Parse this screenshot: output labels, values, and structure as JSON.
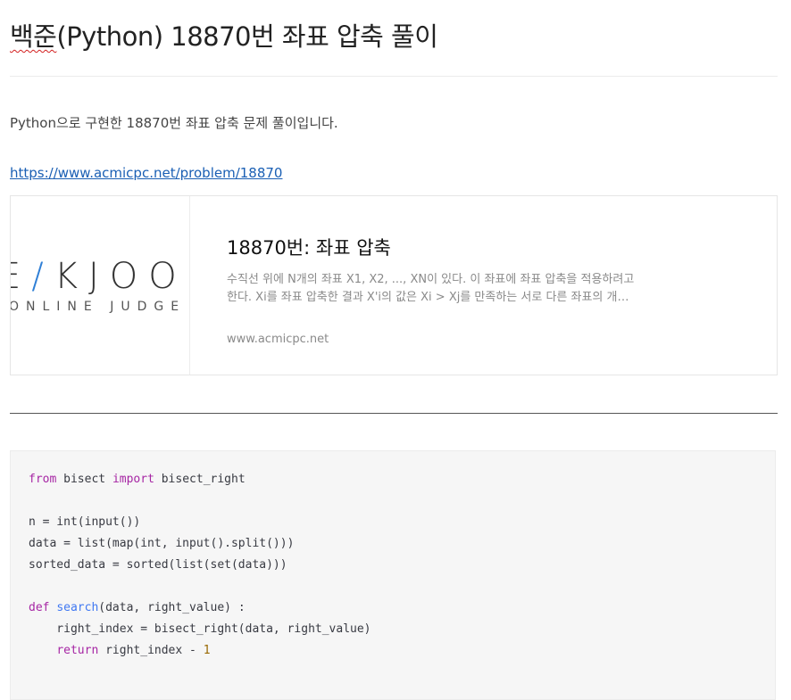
{
  "title": {
    "spell_part": "백준",
    "rest": "(Python) 18870번 좌표 압축 풀이"
  },
  "intro": "Python으로 구현한 18870번 좌표 압축 문제 풀이입니다.",
  "link": {
    "text": "https://www.acmicpc.net/problem/18870"
  },
  "card": {
    "logo_main_left": "E",
    "logo_main_slash": "/",
    "logo_main_right": "KJOO",
    "logo_sub": "ONLINE JUDGE",
    "title": "18870번: 좌표 압축",
    "description": "수직선 위에 N개의 좌표 X1, X2, ..., XN이 있다. 이 좌표에 좌표 압축을 적용하려고 한다. Xi를 좌표 압축한 결과 X'i의 값은 Xi > Xj를 만족하는 서로 다른 좌표의 개…",
    "host": "www.acmicpc.net"
  },
  "code": {
    "line1": {
      "k1": "from",
      "t1": " bisect ",
      "k2": "import",
      "t2": " bisect_right"
    },
    "line3": "n = int(input())",
    "line4": "data = list(map(int, input().split()))",
    "line5": "sorted_data = sorted(list(set(data)))",
    "line7": {
      "k": "def",
      "t1": " ",
      "fn": "search",
      "t2": "(data, right_value) :"
    },
    "line8": "    right_index = bisect_right(data, right_value)",
    "line9": {
      "indent": "    ",
      "k": "return",
      "t": " right_index - ",
      "num": "1"
    }
  }
}
